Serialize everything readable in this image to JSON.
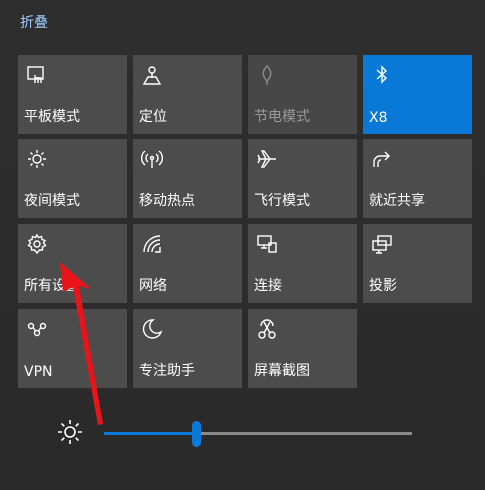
{
  "header": {
    "collapse_label": "折叠"
  },
  "tiles": [
    {
      "label": "平板模式",
      "icon": "tablet-mode-icon",
      "state": "off"
    },
    {
      "label": "定位",
      "icon": "location-icon",
      "state": "off"
    },
    {
      "label": "节电模式",
      "icon": "battery-saver-icon",
      "state": "disabled"
    },
    {
      "label": "X8",
      "icon": "bluetooth-icon",
      "state": "on"
    },
    {
      "label": "夜间模式",
      "icon": "night-light-icon",
      "state": "off"
    },
    {
      "label": "移动热点",
      "icon": "hotspot-icon",
      "state": "off"
    },
    {
      "label": "飞行模式",
      "icon": "airplane-icon",
      "state": "off"
    },
    {
      "label": "就近共享",
      "icon": "nearby-share-icon",
      "state": "off"
    },
    {
      "label": "所有设置",
      "icon": "gear-icon",
      "state": "off"
    },
    {
      "label": "网络",
      "icon": "network-icon",
      "state": "off"
    },
    {
      "label": "连接",
      "icon": "connect-icon",
      "state": "off"
    },
    {
      "label": "投影",
      "icon": "project-icon",
      "state": "off"
    },
    {
      "label": "VPN",
      "icon": "vpn-icon",
      "state": "off"
    },
    {
      "label": "专注助手",
      "icon": "focus-assist-icon",
      "state": "off"
    },
    {
      "label": "屏幕截图",
      "icon": "screen-snip-icon",
      "state": "off"
    }
  ],
  "brightness": {
    "icon": "brightness-icon",
    "level": 0.3
  },
  "colors": {
    "accent": "#0a78d7",
    "tile": "#4c4c4c",
    "annotation": "#e8141a"
  }
}
